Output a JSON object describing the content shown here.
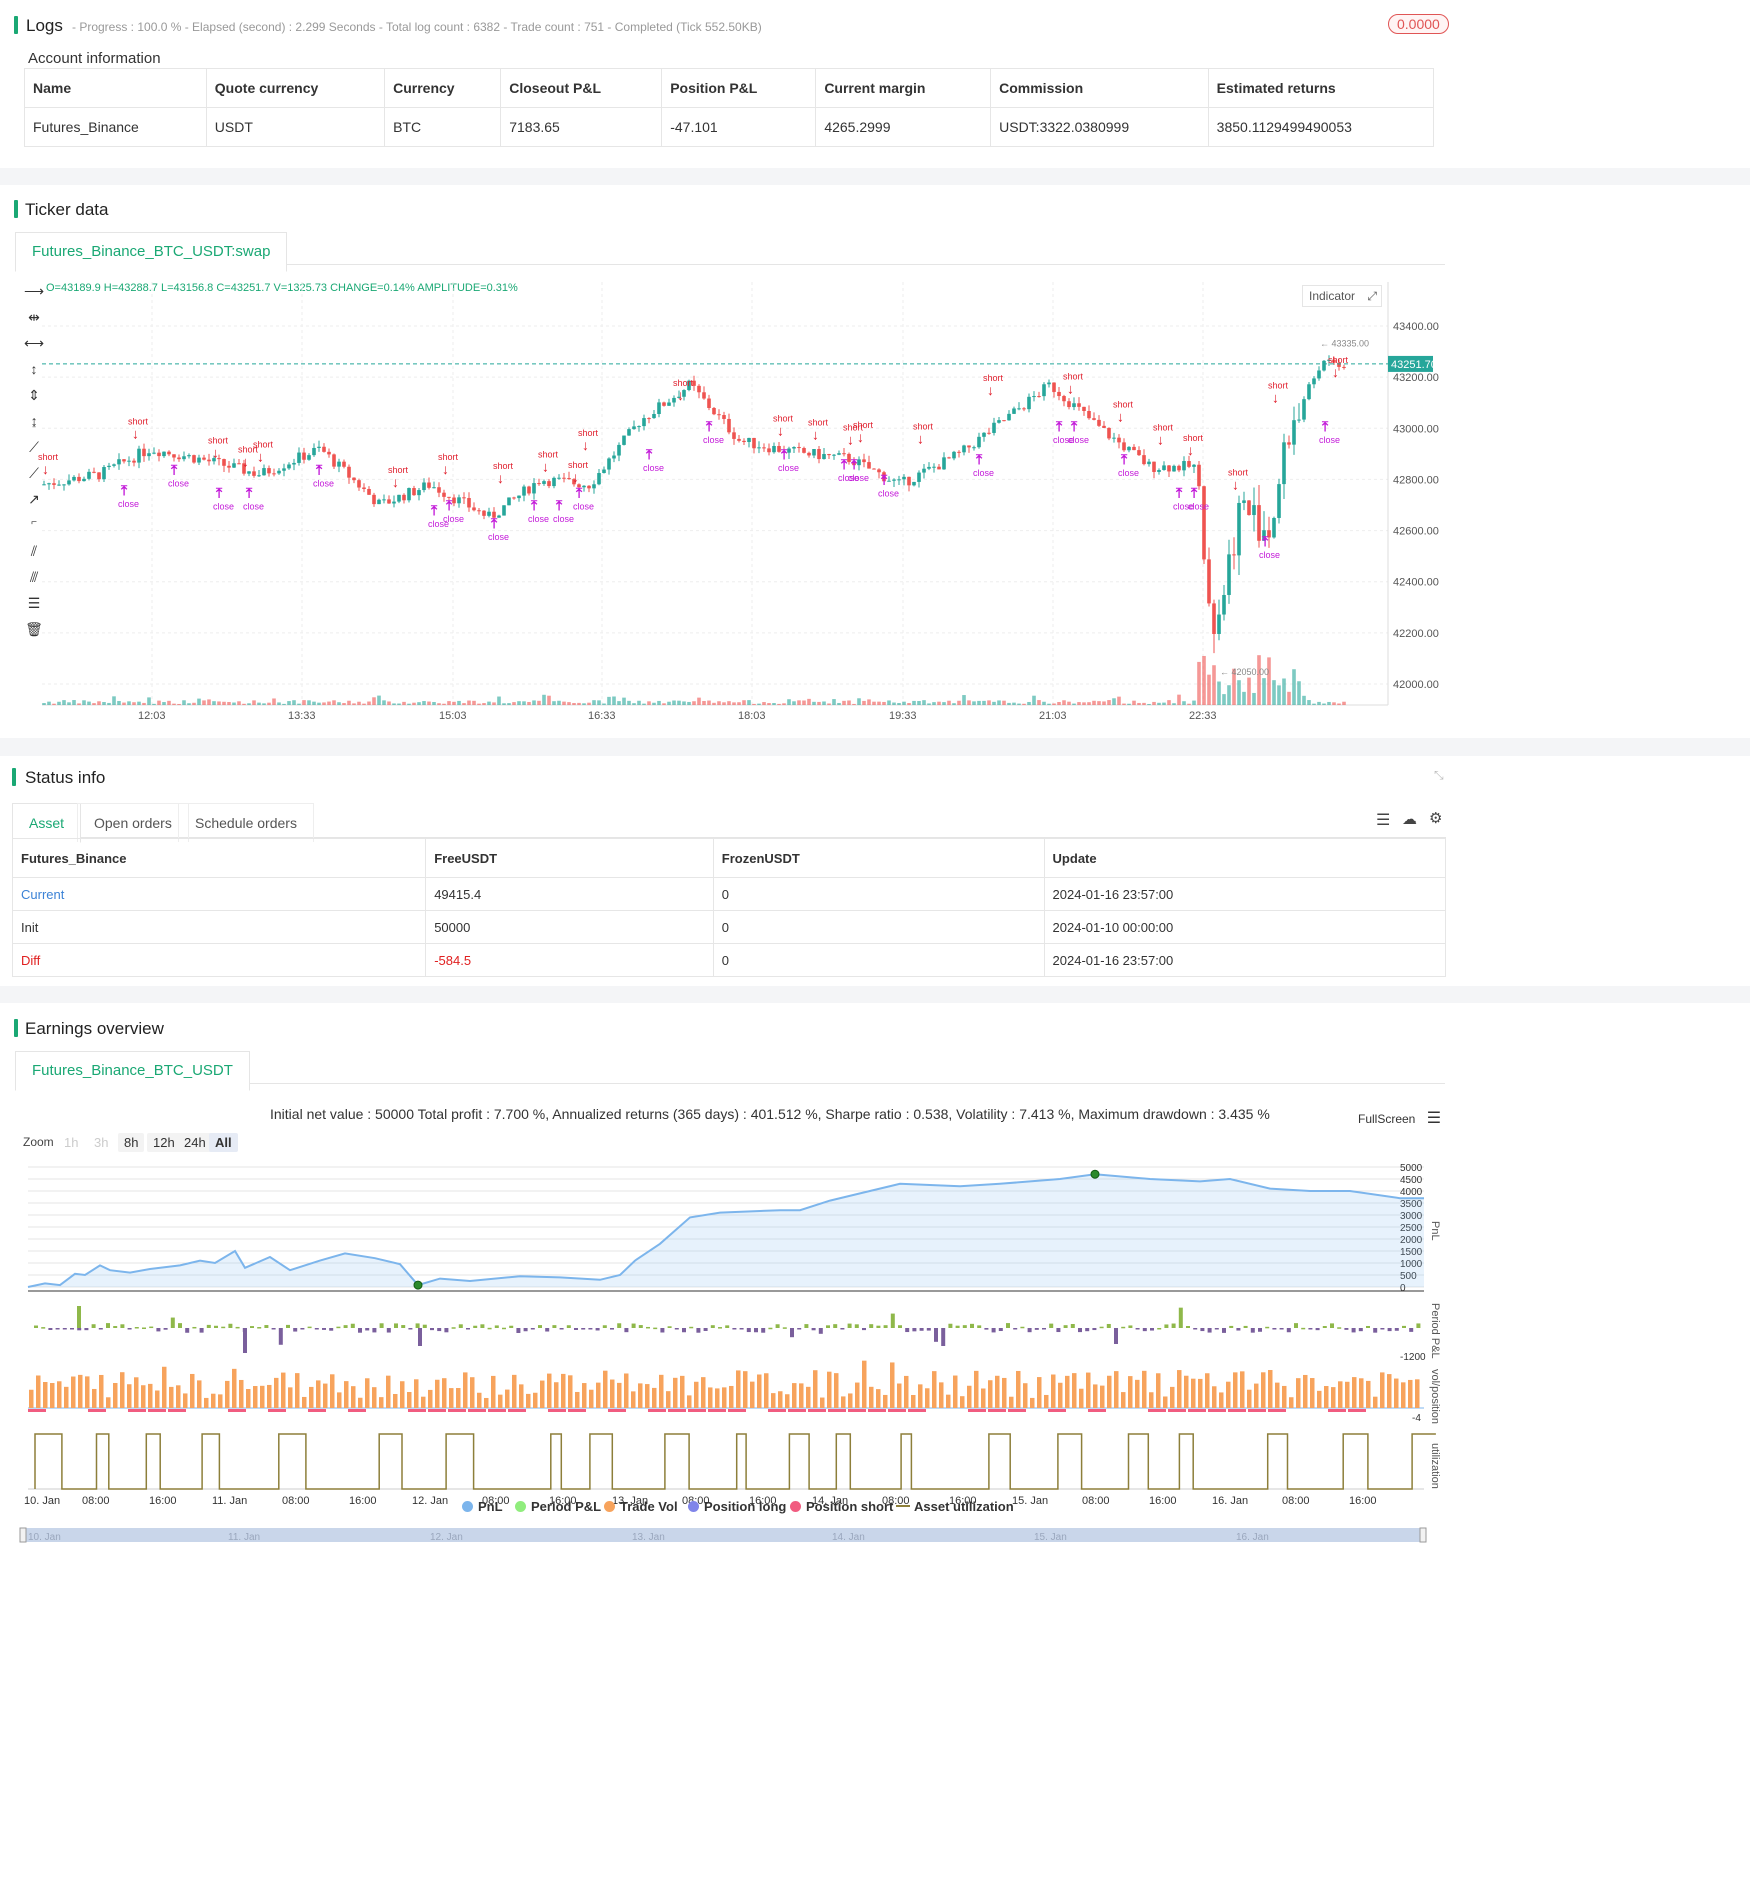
{
  "logs": {
    "title": "Logs",
    "summary": "- Progress : 100.0 % - Elapsed (second) : 2.299  Seconds - Total log count : 6382 - Trade count : 751 - Completed (Tick 552.50KB)",
    "badge": "0.0000"
  },
  "account": {
    "title": "Account information",
    "columns": [
      "Name",
      "Quote currency",
      "Currency",
      "Closeout P&L",
      "Position P&L",
      "Current margin",
      "Commission",
      "Estimated returns"
    ],
    "row": [
      "Futures_Binance",
      "USDT",
      "BTC",
      "7183.65",
      "-47.101",
      "4265.2999",
      "USDT:3322.0380999",
      "3850.1129499490053"
    ]
  },
  "ticker": {
    "title": "Ticker data",
    "tab": "Futures_Binance_BTC_USDT:swap",
    "ohlc": "O=43189.9 H=43288.7 L=43156.8 C=43251.7 V=1325.73 CHANGE=0.14% AMPLITUDE=0.31%",
    "indicator_label": "Indicator",
    "last_price": "43251.70",
    "high_label": "43335.00",
    "low_label": "42050.00",
    "y_ticks": [
      "43400.00",
      "43200.00",
      "43000.00",
      "42800.00",
      "42600.00",
      "42400.00",
      "42200.00",
      "42000.00"
    ],
    "x_ticks": [
      "12:03",
      "13:33",
      "15:03",
      "16:33",
      "18:03",
      "19:33",
      "21:03",
      "22:33"
    ],
    "short_label": "short",
    "close_label": "close",
    "colors": {
      "up": "#26a69a",
      "down": "#ef5350",
      "short": "#e0202e",
      "close": "#c31ad9"
    }
  },
  "status": {
    "title": "Status info",
    "tabs": [
      "Asset",
      "Open orders",
      "Schedule orders"
    ],
    "columns": [
      "Futures_Binance",
      "FreeUSDT",
      "FrozenUSDT",
      "Update"
    ],
    "rows": [
      [
        "Current",
        "49415.4",
        "0",
        "2024-01-16 23:57:00"
      ],
      [
        "Init",
        "50000",
        "0",
        "2024-01-10 00:00:00"
      ],
      [
        "Diff",
        "-584.5",
        "0",
        "2024-01-16 23:57:00"
      ]
    ]
  },
  "earnings": {
    "title": "Earnings overview",
    "tab": "Futures_Binance_BTC_USDT",
    "summary": "Initial net value : 50000 Total profit : 7.700 %, Annualized returns (365 days) : 401.512 %, Sharpe ratio : 0.538, Volatility : 7.413 %, Maximum drawdown : 3.435 %",
    "fullscreen": "FullScreen",
    "zoom_label": "Zoom",
    "zoom_buttons": [
      "1h",
      "3h",
      "8h",
      "12h",
      "24h",
      "All"
    ],
    "pnl_ticks": [
      "5000",
      "4500",
      "4000",
      "3500",
      "3000",
      "2500",
      "2000",
      "1500",
      "1000",
      "500",
      "0"
    ],
    "axis_labels": [
      "PnL",
      "Period P&L",
      "vol/position",
      "utilization"
    ],
    "period_low": "-1200",
    "vol_low": "-4",
    "x_ticks": [
      "10. Jan",
      "08:00",
      "16:00",
      "11. Jan",
      "08:00",
      "16:00",
      "12. Jan",
      "08:00",
      "16:00",
      "13. Jan",
      "08:00",
      "16:00",
      "14. Jan",
      "08:00",
      "16:00",
      "15. Jan",
      "08:00",
      "16:00",
      "16. Jan",
      "08:00",
      "16:00"
    ],
    "nav_ticks": [
      "10. Jan",
      "11. Jan",
      "12. Jan",
      "13. Jan",
      "14. Jan",
      "15. Jan",
      "16. Jan"
    ],
    "legend": [
      {
        "name": "PnL",
        "color": "#7cb5ec"
      },
      {
        "name": "Period P&L",
        "color": "#90ed7d"
      },
      {
        "name": "Trade Vol",
        "color": "#f7a35c"
      },
      {
        "name": "Position long",
        "color": "#8085e9"
      },
      {
        "name": "Position short",
        "color": "#f15c80"
      },
      {
        "name": "Asset utilization",
        "color": "#8d7f3a"
      }
    ]
  }
}
